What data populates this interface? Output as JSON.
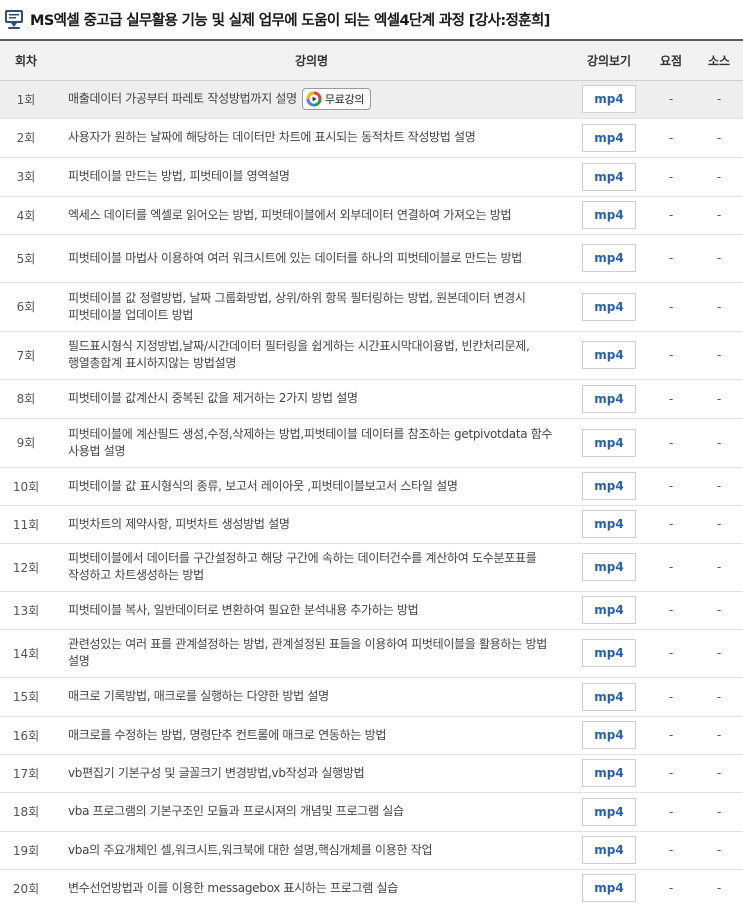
{
  "title": "MS엑셀 중고급 실무활용 기능 및 실제 업무에 도움이 되는 엑셀4단계 과정 [강사:정훈희]",
  "icons": {
    "title": "monitor-chat-icon",
    "free": "play-circle-icon"
  },
  "headers": {
    "num": "회차",
    "title": "강의명",
    "view": "강의보기",
    "summary": "요점",
    "source": "소스"
  },
  "free_label": "무료강의",
  "mp4_label": "mp4",
  "dash": "-",
  "rows": [
    {
      "num": "1회",
      "title": "매출데이터 가공부터 파레토 작성방법까지 설명",
      "free": true
    },
    {
      "num": "2회",
      "title": "사용자가 원하는 날짜에 해당하는 데이터만 차트에 표시되는 동적차트 작성방법 설명"
    },
    {
      "num": "3회",
      "title": "피벗테이블 만드는 방법, 피벗테이블 영역설명"
    },
    {
      "num": "4회",
      "title": "엑세스 데이터를 엑셀로 읽어오는 방법, 피벗테이블에서 외부데이터 연결하여 가져오는 방법"
    },
    {
      "num": "5회",
      "title": "피벗테이블 마법사 이용하여 여러 워크시트에 있는 데이터를 하나의 피벗테이블로 만드는 방법"
    },
    {
      "num": "6회",
      "title": "피벗테이블 값 정렬방법, 날짜 그룹화방법, 상위/하위 항목 필터링하는 방법, 원본데이터 변경시 피벗테이블 업데이트 방법"
    },
    {
      "num": "7회",
      "title": "필드표시형식 지정방법,날짜/시간데이터 필터링을 쉽게하는 시간표시막대이용법, 빈칸처리문제, 행열총합계 표시하지않는 방법설명"
    },
    {
      "num": "8회",
      "title": "피벗테이블 값계산시 중복된 값을 제거하는 2가지 방법 설명"
    },
    {
      "num": "9회",
      "title": "피벗테이블에 계산필드 생성,수정,삭제하는 방법,피벗테이블 데이터를 참조하는 getpivotdata 함수 사용법 설명"
    },
    {
      "num": "10회",
      "title": "피벗테이블 값 표시형식의 종류, 보고서 레이아웃 ,피벗테이블보고서 스타일 설명"
    },
    {
      "num": "11회",
      "title": "피벗차트의 제약사항, 피벗차트 생성방법 설명"
    },
    {
      "num": "12회",
      "title": "피벗테이블에서 데이터를 구간설정하고 해당 구간에 속하는 데이터건수를 계산하여 도수분포표를 작성하고 차트생성하는 방법"
    },
    {
      "num": "13회",
      "title": "피벗테이블 복사, 일반데이터로 변환하여 필요한 분석내용 추가하는 방법"
    },
    {
      "num": "14회",
      "title": "관련성있는 여러 표를 관계설정하는 방법, 관계설정된 표들을 이용하여 피벗테이블을 활용하는 방법 설명"
    },
    {
      "num": "15회",
      "title": "매크로 기록방법, 매크로를 실행하는 다양한 방법 설명"
    },
    {
      "num": "16회",
      "title": "매크로를 수정하는 방법, 명령단추 컨트롤에 매크로 연동하는 방법"
    },
    {
      "num": "17회",
      "title": "vb편집기 기본구성 및 글꼴크기 변경방법,vb작성과 실행방법"
    },
    {
      "num": "18회",
      "title": "vba 프로그램의 기본구조인 모듈과 프로시져의 개념및 프로그램 실습"
    },
    {
      "num": "19회",
      "title": "vba의 주요개체인 셀,워크시트,워크북에 대한 설명,핵심개체를 이용한 작업"
    },
    {
      "num": "20회",
      "title": "변수선언방법과 이를 이용한 messagebox 표시하는 프로그램 실습"
    }
  ]
}
